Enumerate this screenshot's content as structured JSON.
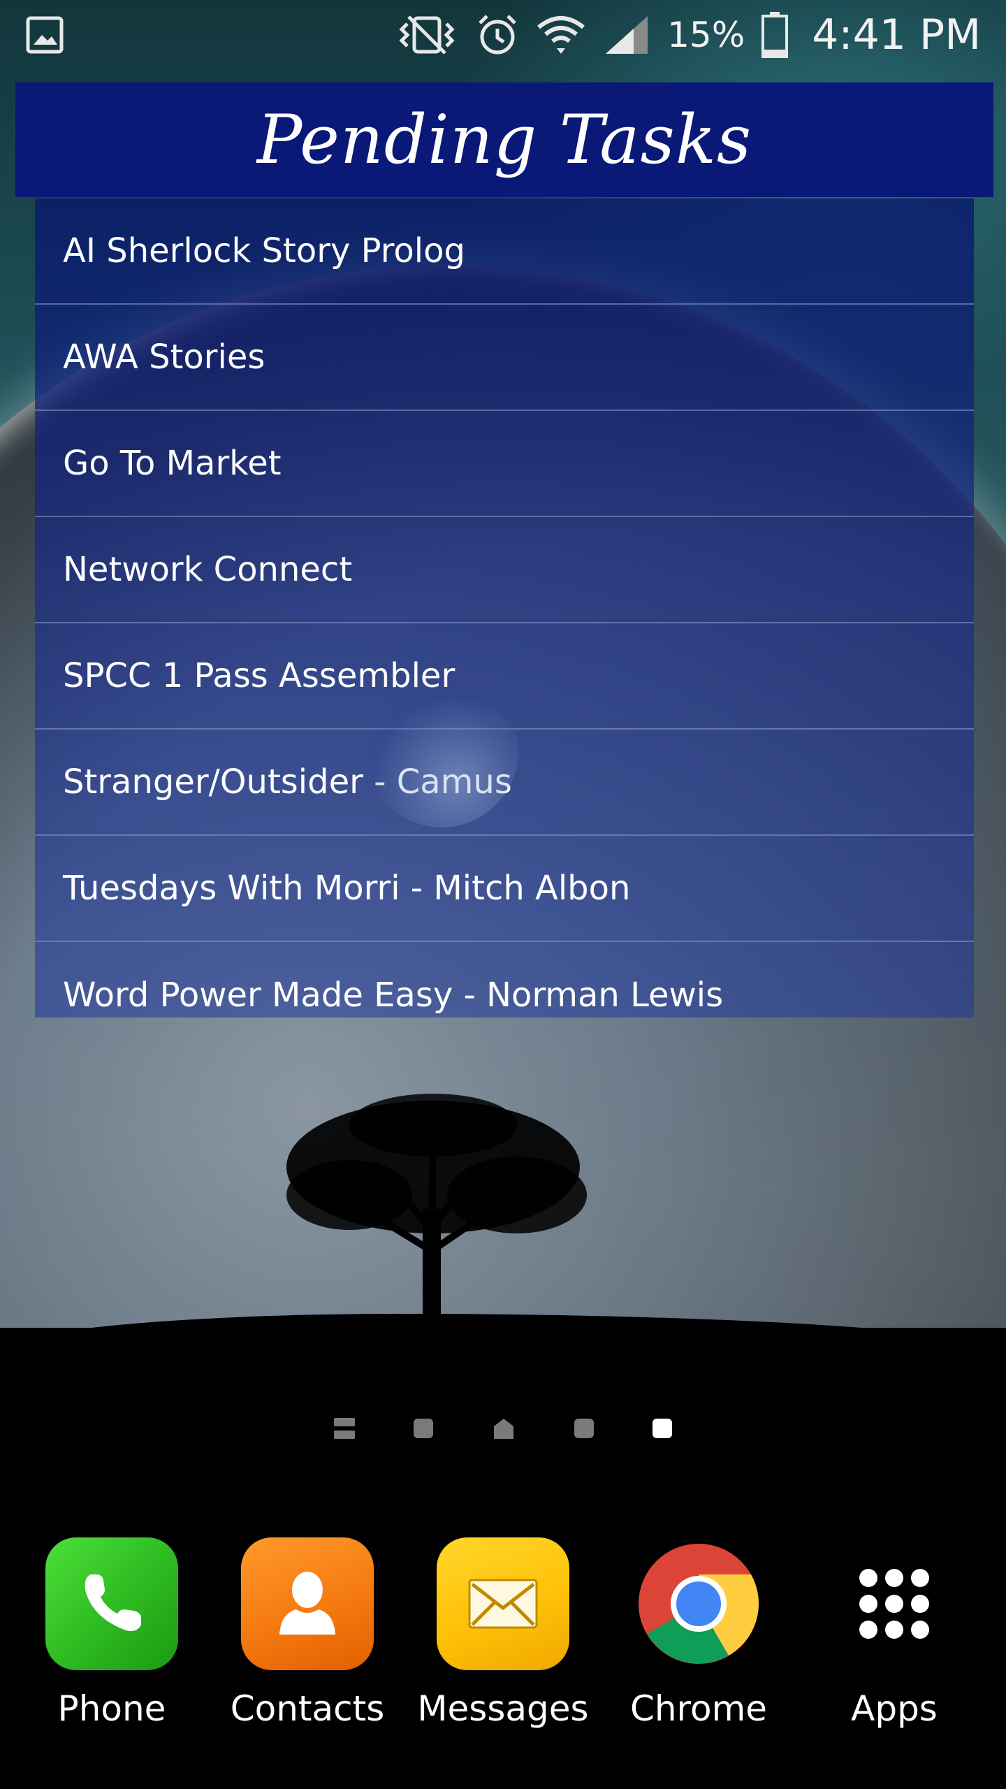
{
  "status_bar": {
    "battery_percent": "15%",
    "time": "4:41 PM",
    "icons": [
      "gallery-icon",
      "vibrate-icon",
      "alarm-icon",
      "wifi-icon",
      "signal-icon",
      "battery-icon"
    ]
  },
  "widget": {
    "title": "Pending Tasks",
    "header_color": "#0a1877",
    "tasks": [
      "AI Sherlock Story Prolog",
      "AWA Stories",
      "Go To Market",
      "Network Connect",
      "SPCC 1 Pass Assembler",
      "Stranger/Outsider - Camus",
      "Tuesdays With Morri - Mitch Albon",
      "Word Power Made Easy - Norman Lewis"
    ]
  },
  "page_indicator": {
    "pages": [
      "menu",
      "page",
      "home",
      "page",
      "page"
    ],
    "active_index": 4
  },
  "dock": {
    "apps": [
      {
        "label": "Phone",
        "icon": "phone-icon"
      },
      {
        "label": "Contacts",
        "icon": "contacts-icon"
      },
      {
        "label": "Messages",
        "icon": "messages-icon"
      },
      {
        "label": "Chrome",
        "icon": "chrome-icon"
      },
      {
        "label": "Apps",
        "icon": "apps-grid-icon"
      }
    ]
  }
}
